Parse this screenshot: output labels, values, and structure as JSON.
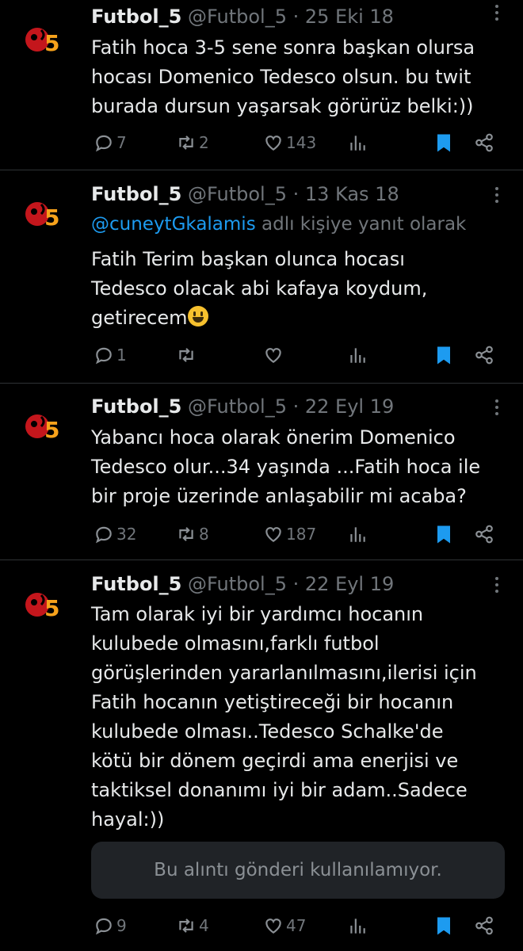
{
  "tweets": [
    {
      "name": "Futbol_5",
      "meta": "@Futbol_5 · 25 Eki 18",
      "reply_prefix": "",
      "reply_handle": "",
      "reply_suffix": "",
      "text": "Fatih hoca 3-5 sene sonra  başkan olursa\nhocası Domenico Tedesco olsun. bu twit\nburada dursun yaşarsak görürüz belki:))",
      "replies": "7",
      "retweets": "2",
      "likes": "143"
    },
    {
      "name": "Futbol_5",
      "meta": "@Futbol_5 · 13 Kas 18",
      "reply_handle": "@cuneytGkalamis",
      "reply_suffix": " adlı kişiye yanıt olarak",
      "text": "Fatih Terim başkan olunca hocası\nTedesco olacak abi kafaya koydum,\ngetirecem",
      "replies": "1",
      "retweets": "",
      "likes": ""
    },
    {
      "name": "Futbol_5",
      "meta": "@Futbol_5 · 22 Eyl 19",
      "text": "Yabancı hoca olarak önerim Domenico\nTedesco olur...34 yaşında ...Fatih hoca ile\nbir proje üzerinde anlaşabilir mi acaba?",
      "replies": "32",
      "retweets": "8",
      "likes": "187"
    },
    {
      "name": "Futbol_5",
      "meta": "@Futbol_5 · 22 Eyl 19",
      "text": "Tam olarak iyi bir yardımcı hocanın\nkulubede olmasını,farklı futbol\ngörüşlerinden yararlanılmasını,ilerisi için\nFatih hocanın yetiştireceği bir hocanın\nkulubede olması..Tedesco Schalke'de\nkötü bir dönem geçirdi ama enerjisi ve\ntaktiksel donanımı iyi bir adam..Sadece\nhayal:))",
      "quote_unavailable": "Bu alıntı gönderi kullanılamıyor.",
      "replies": "9",
      "retweets": "4",
      "likes": "47"
    }
  ],
  "icons": {
    "reply": "reply-icon",
    "retweet": "retweet-icon",
    "like": "heart-icon",
    "views": "views-icon",
    "bookmark": "bookmark-icon",
    "share": "share-icon",
    "more": "more-icon"
  },
  "colors": {
    "background": "#000000",
    "text": "#e7e9ea",
    "muted": "#71767b",
    "accent": "#1d9bf0",
    "divider": "#2f3336"
  }
}
